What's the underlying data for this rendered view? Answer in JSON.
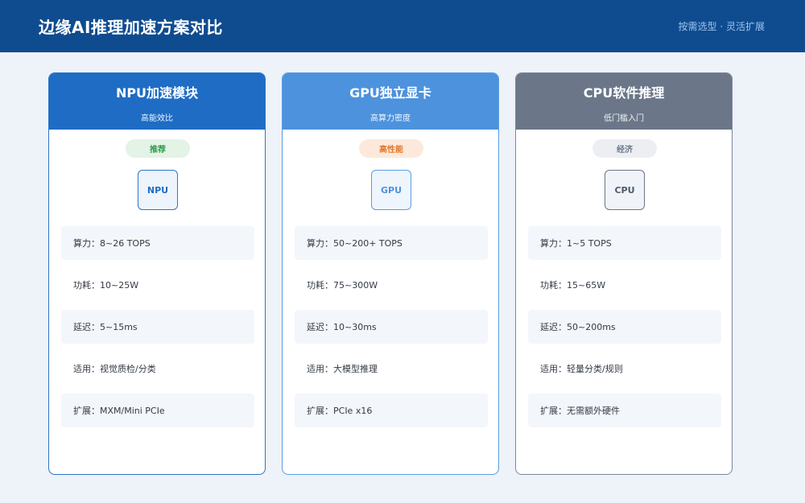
{
  "header": {
    "title": "边缘AI推理加速方案对比",
    "subtitle": "按需选型 · 灵活扩展"
  },
  "cards": [
    {
      "title": "NPU加速模块",
      "subtitle": "高能效比",
      "badge": "推荐",
      "chip": "NPU",
      "rows": [
        "算力：8~26 TOPS",
        "功耗：10~25W",
        "延迟：5~15ms",
        "适用：视觉质检/分类",
        "扩展：MXM/Mini PCIe"
      ]
    },
    {
      "title": "GPU独立显卡",
      "subtitle": "高算力密度",
      "badge": "高性能",
      "chip": "GPU",
      "rows": [
        "算力：50~200+ TOPS",
        "功耗：75~300W",
        "延迟：10~30ms",
        "适用：大模型推理",
        "扩展：PCIe x16"
      ]
    },
    {
      "title": "CPU软件推理",
      "subtitle": "低门槛入门",
      "badge": "经济",
      "chip": "CPU",
      "rows": [
        "算力：1~5 TOPS",
        "功耗：15~65W",
        "延迟：50~200ms",
        "适用：轻量分类/规则",
        "扩展：无需额外硬件"
      ]
    }
  ]
}
